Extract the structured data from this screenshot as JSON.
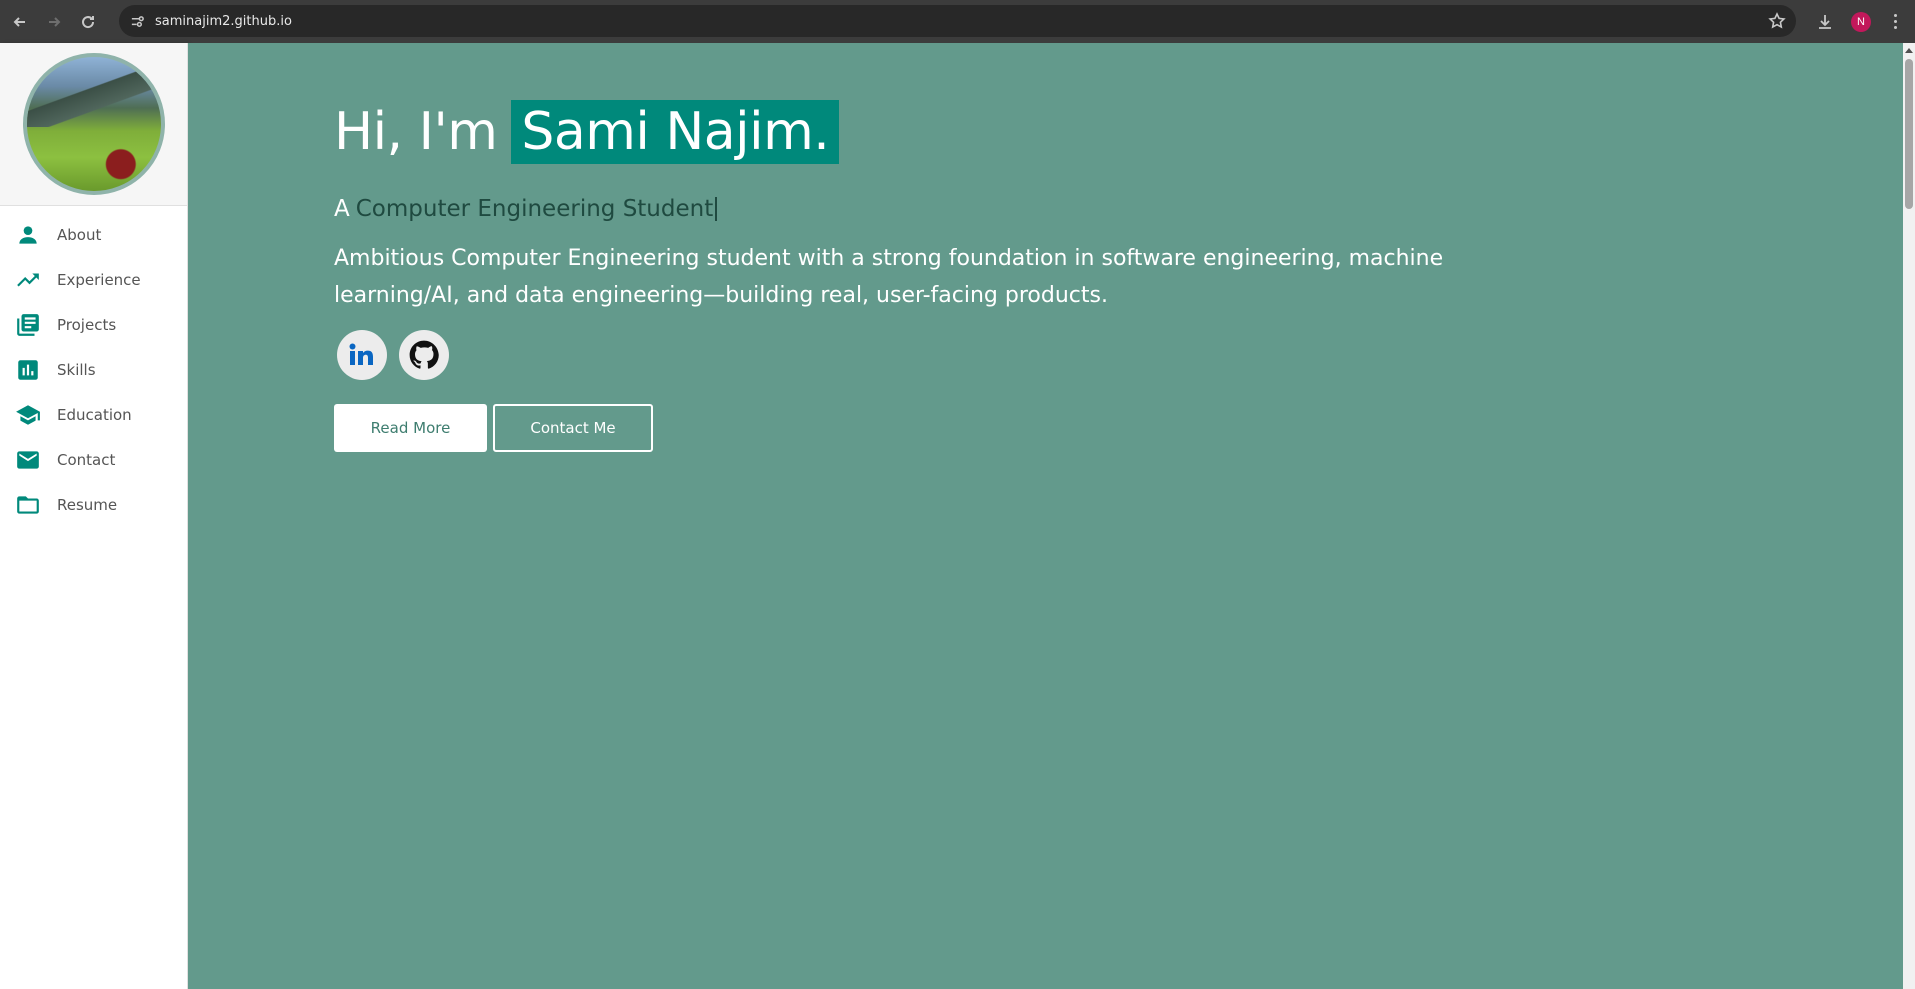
{
  "browser": {
    "url": "saminajim2.github.io",
    "profile_initial": "N",
    "icons": [
      "back-icon",
      "forward-icon",
      "reload-icon",
      "site-info-icon",
      "bookmark-star-icon",
      "download-icon",
      "menu-icon"
    ]
  },
  "sidebar": {
    "items": [
      {
        "label": "About",
        "icon": "person-icon"
      },
      {
        "label": "Experience",
        "icon": "trending-up-icon"
      },
      {
        "label": "Projects",
        "icon": "library-books-icon"
      },
      {
        "label": "Skills",
        "icon": "bar-chart-icon"
      },
      {
        "label": "Education",
        "icon": "school-icon"
      },
      {
        "label": "Contact",
        "icon": "mail-icon"
      },
      {
        "label": "Resume",
        "icon": "folder-icon"
      }
    ]
  },
  "hero": {
    "greeting": "Hi, I'm",
    "name": "Sami Najim.",
    "subtitle_prefix": "A",
    "role": "Computer Engineering Student",
    "intro": "Ambitious Computer Engineering student with a strong foundation in software engineering, machine learning/AI, and data engineering—building real, user-facing products.",
    "socials": [
      {
        "name": "LinkedIn",
        "icon": "linkedin-icon"
      },
      {
        "name": "GitHub",
        "icon": "github-icon"
      }
    ],
    "buttons": {
      "read_more": "Read More",
      "contact_me": "Contact Me"
    }
  },
  "colors": {
    "hero_bg": "#639a8c",
    "accent": "#00897b",
    "role_text": "#1f4a40"
  }
}
